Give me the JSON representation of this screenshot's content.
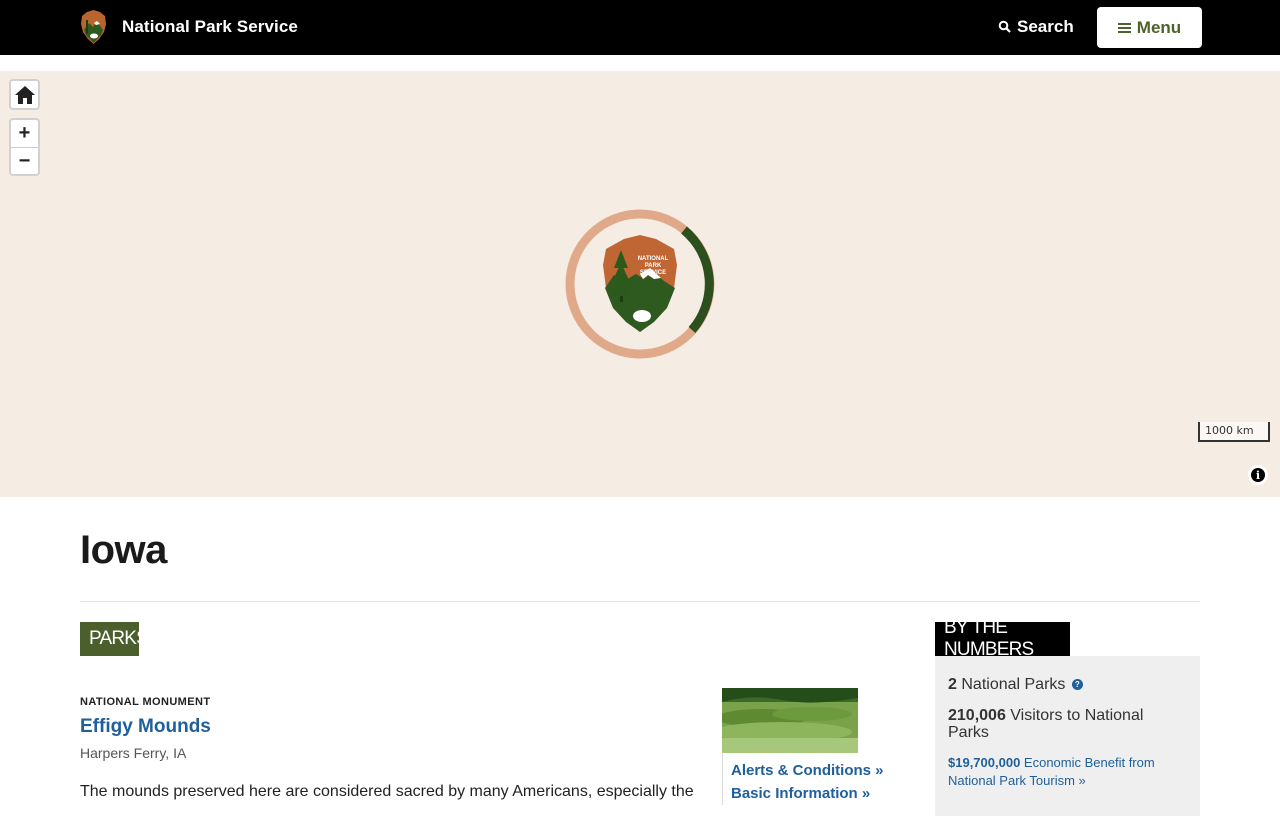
{
  "header": {
    "site_name": "National Park Service",
    "search_label": "Search",
    "menu_label": "Menu"
  },
  "map": {
    "scale_label": "1000 km",
    "info_label": "i",
    "zoom_in_label": "+",
    "zoom_out_label": "−"
  },
  "page": {
    "title": "Iowa"
  },
  "parks_section": {
    "label": "PARKS",
    "park": {
      "type": "NATIONAL MONUMENT",
      "name": "Effigy Mounds",
      "location": "Harpers Ferry, IA",
      "description": "The mounds preserved here are considered sacred by many Americans, especially the",
      "links": [
        "Alerts & Conditions »",
        "Basic Information »"
      ]
    }
  },
  "numbers_section": {
    "label": "BY THE NUMBERS",
    "parks_count": "2",
    "parks_text": "National Parks",
    "visitors_count": "210,006",
    "visitors_text": "Visitors to National Parks",
    "benefit_amount": "$19,700,000",
    "benefit_text": "Economic Benefit from National Park Tourism »"
  },
  "colors": {
    "header_bg": "#000000",
    "brand_green": "#4b5f2c",
    "link_blue": "#1f5f9b",
    "map_bg": "#f5ece4",
    "loader_ring": "#e0aa8a",
    "loader_arc": "#2d4f1e"
  }
}
